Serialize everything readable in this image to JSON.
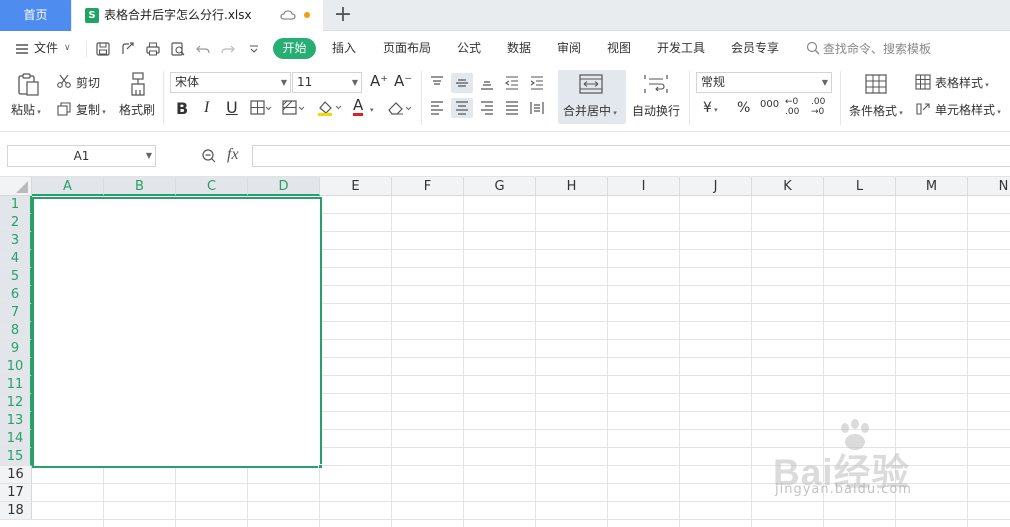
{
  "tabs": {
    "home_label": "首页",
    "file_icon_letter": "S",
    "file_title": "表格合并后字怎么分行.xlsx",
    "add_label": "+"
  },
  "menu": {
    "file_label": "文件",
    "items": [
      "开始",
      "插入",
      "页面布局",
      "公式",
      "数据",
      "审阅",
      "视图",
      "开发工具",
      "会员专享"
    ],
    "search_placeholder": "查找命令、搜索模板"
  },
  "ribbon": {
    "paste": "粘贴",
    "cut": "剪切",
    "copy": "复制",
    "format_painter": "格式刷",
    "font_name": "宋体",
    "font_size": "11",
    "bold": "B",
    "italic": "I",
    "underline": "U",
    "font_color_glyph": "A",
    "merge_center": "合并居中",
    "wrap_text": "自动换行",
    "number_format": "常规",
    "currency": "¥",
    "percent": "%",
    "thousands": "000",
    "dec_inc": "←0 .00",
    "dec_dec": ".00 →0",
    "conditional_format": "条件格式",
    "table_style": "表格样式",
    "cell_style": "单元格样式"
  },
  "formula_bar": {
    "cell_ref": "A1",
    "fx_label": "fx",
    "formula_value": ""
  },
  "grid": {
    "columns": [
      "A",
      "B",
      "C",
      "D",
      "E",
      "F",
      "G",
      "H",
      "I",
      "J",
      "K",
      "L",
      "M",
      "N"
    ],
    "selected_columns": [
      "A",
      "B",
      "C",
      "D"
    ],
    "rows": [
      "1",
      "2",
      "3",
      "4",
      "5",
      "6",
      "7",
      "8",
      "9",
      "10",
      "11",
      "12",
      "13",
      "14",
      "15",
      "16",
      "17",
      "18"
    ],
    "selected_rows": 15,
    "merged_range": "A1:D15"
  },
  "watermark": {
    "text": "Bai经验",
    "url": "jingyan.baidu.com"
  },
  "colors": {
    "accent_green": "#27a06a",
    "home_tab_blue": "#4e8cf0"
  }
}
